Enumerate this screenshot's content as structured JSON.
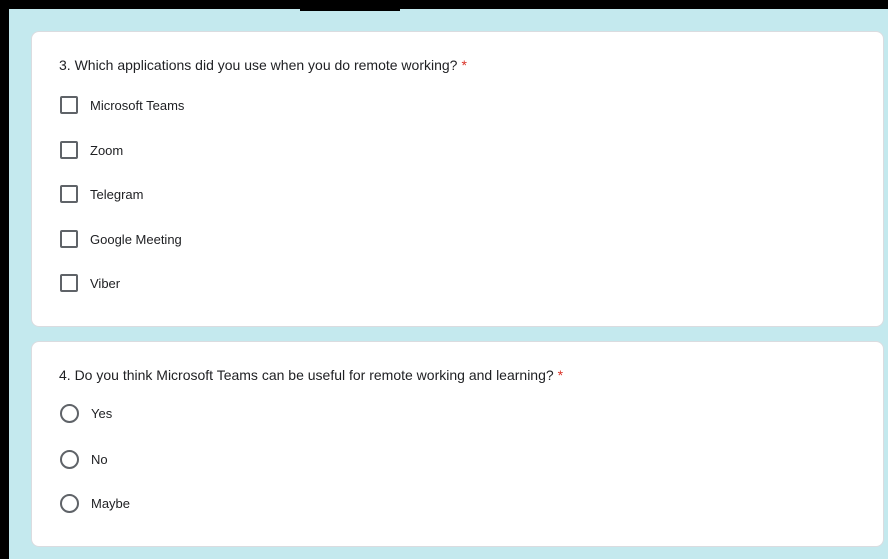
{
  "questions": [
    {
      "text": "3. Which applications did you use when you do remote working?",
      "required_mark": "*",
      "type": "checkbox",
      "options": [
        {
          "label": "Microsoft Teams",
          "checked": false
        },
        {
          "label": "Zoom",
          "checked": false
        },
        {
          "label": "Telegram",
          "checked": false
        },
        {
          "label": "Google Meeting",
          "checked": false
        },
        {
          "label": "Viber",
          "checked": false
        }
      ]
    },
    {
      "text": "4. Do you think Microsoft Teams can be useful for remote working and learning?",
      "required_mark": "*",
      "type": "radio",
      "options": [
        {
          "label": "Yes",
          "selected": false
        },
        {
          "label": "No",
          "selected": false
        },
        {
          "label": "Maybe",
          "selected": false
        }
      ]
    }
  ],
  "colors": {
    "page_background": "#c4e9ee",
    "card_background": "#ffffff",
    "required": "#d93025",
    "control_border": "#5f6368"
  }
}
